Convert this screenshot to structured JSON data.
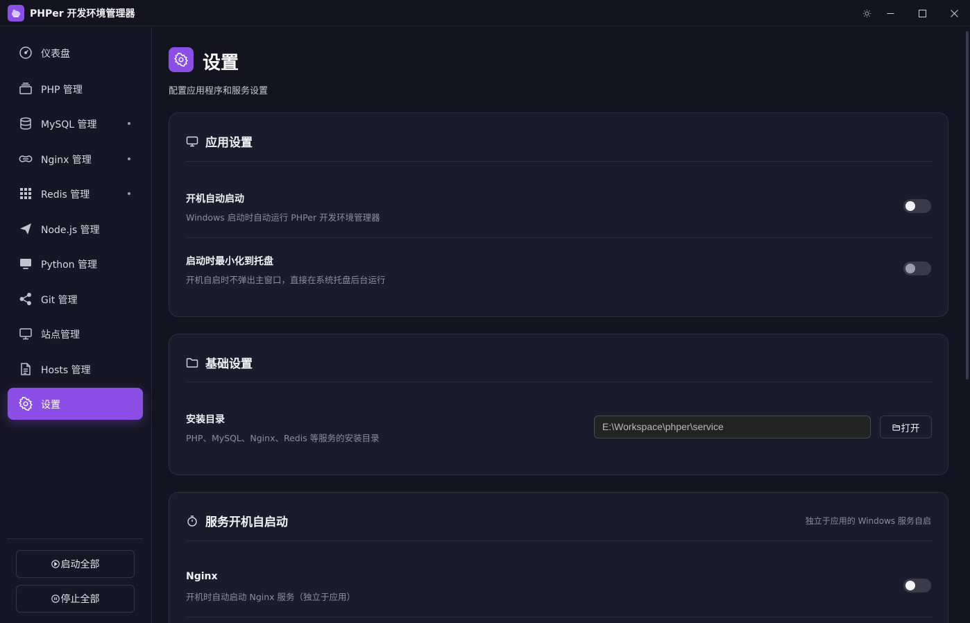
{
  "app": {
    "title": "PHPer 开发环境管理器"
  },
  "sidebar": {
    "items": [
      {
        "label": "仪表盘",
        "icon": "dashboard-icon",
        "dot": false,
        "active": false
      },
      {
        "label": "PHP 管理",
        "icon": "layers-icon",
        "dot": false,
        "active": false
      },
      {
        "label": "MySQL 管理",
        "icon": "database-icon",
        "dot": true,
        "active": false
      },
      {
        "label": "Nginx 管理",
        "icon": "nginx-icon",
        "dot": true,
        "active": false
      },
      {
        "label": "Redis 管理",
        "icon": "grid-icon",
        "dot": true,
        "active": false
      },
      {
        "label": "Node.js 管理",
        "icon": "send-icon",
        "dot": false,
        "active": false
      },
      {
        "label": "Python 管理",
        "icon": "monitor-icon",
        "dot": false,
        "active": false
      },
      {
        "label": "Git 管理",
        "icon": "share-icon",
        "dot": false,
        "active": false
      },
      {
        "label": "站点管理",
        "icon": "desktop-icon",
        "dot": false,
        "active": false
      },
      {
        "label": "Hosts 管理",
        "icon": "file-icon",
        "dot": false,
        "active": false
      },
      {
        "label": "设置",
        "icon": "gear-icon",
        "dot": false,
        "active": true
      }
    ],
    "start_all": "启动全部",
    "stop_all": "停止全部"
  },
  "page": {
    "title": "设置",
    "subtitle": "配置应用程序和服务设置"
  },
  "app_settings": {
    "title": "应用设置",
    "autostart": {
      "title": "开机自动启动",
      "desc": "Windows 启动时自动运行 PHPer 开发环境管理器",
      "enabled": false
    },
    "minimize": {
      "title": "启动时最小化到托盘",
      "desc": "开机自启时不弹出主窗口，直接在系统托盘后台运行",
      "enabled": false
    }
  },
  "basic_settings": {
    "title": "基础设置",
    "install_dir": {
      "title": "安装目录",
      "desc": "PHP、MySQL、Nginx、Redis 等服务的安装目录",
      "value": "E:\\Workspace\\phper\\service",
      "open_label": "打开"
    }
  },
  "service_autostart": {
    "title": "服务开机自启动",
    "note": "独立于应用的 Windows 服务自启",
    "nginx": {
      "title": "Nginx",
      "desc": "开机时自动启动 Nginx 服务（独立于应用）",
      "enabled": false
    }
  },
  "colors": {
    "accent": "#8b4fe6",
    "background": "#141421",
    "card": "#1b1b2e"
  }
}
